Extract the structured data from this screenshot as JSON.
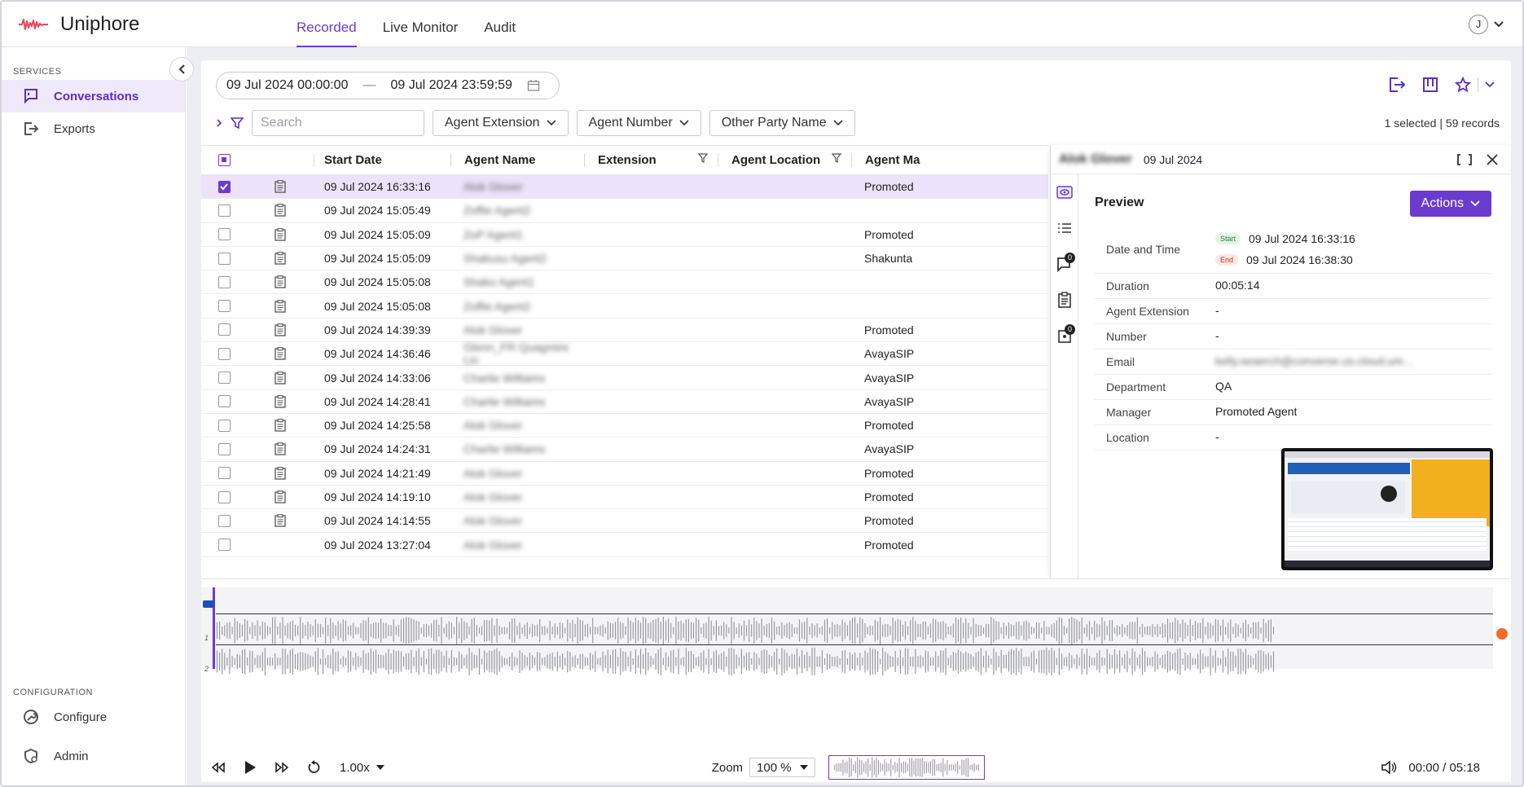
{
  "app": {
    "name": "Uniphore"
  },
  "nav": {
    "tabs": [
      {
        "label": "Recorded",
        "active": true
      },
      {
        "label": "Live Monitor",
        "active": false
      },
      {
        "label": "Audit",
        "active": false
      }
    ]
  },
  "user": {
    "initial": "J"
  },
  "sidebar": {
    "services_label": "SERVICES",
    "items": [
      {
        "label": "Conversations",
        "icon": "chat-icon",
        "active": true
      },
      {
        "label": "Exports",
        "icon": "export-icon",
        "active": false
      }
    ],
    "config_label": "CONFIGURATION",
    "config_items": [
      {
        "label": "Configure",
        "icon": "wrench-icon"
      },
      {
        "label": "Admin",
        "icon": "admin-shield-icon"
      }
    ]
  },
  "date_range": {
    "from": "09 Jul 2024 00:00:00",
    "separator": "—",
    "to": "09 Jul 2024 23:59:59"
  },
  "filters": {
    "search_placeholder": "Search",
    "dropdowns": [
      "Agent Extension",
      "Agent Number",
      "Other Party Name"
    ],
    "records_text": "1 selected | 59 records"
  },
  "table": {
    "headers": {
      "start": "Start Date",
      "agent": "Agent Name",
      "extension": "Extension",
      "location": "Agent Location",
      "manager": "Agent Ma"
    },
    "rows": [
      {
        "start": "09 Jul 2024 16:33:16",
        "agent": "Alok Glover",
        "manager": "Promoted",
        "selected": true,
        "has_icon": true
      },
      {
        "start": "09 Jul 2024 15:05:49",
        "agent": "Zoffie Agent2",
        "manager": "",
        "selected": false,
        "has_icon": true
      },
      {
        "start": "09 Jul 2024 15:05:09",
        "agent": "ZoP Agent1",
        "manager": "Promoted",
        "selected": false,
        "has_icon": true
      },
      {
        "start": "09 Jul 2024 15:05:09",
        "agent": "Shakusu Agent2",
        "manager": "Shakunta",
        "selected": false,
        "has_icon": true
      },
      {
        "start": "09 Jul 2024 15:05:08",
        "agent": "Shako Agent1",
        "manager": "",
        "selected": false,
        "has_icon": true
      },
      {
        "start": "09 Jul 2024 15:05:08",
        "agent": "Zoffie Agent2",
        "manager": "",
        "selected": false,
        "has_icon": true
      },
      {
        "start": "09 Jul 2024 14:39:39",
        "agent": "Alok Glover",
        "manager": "Promoted",
        "selected": false,
        "has_icon": true
      },
      {
        "start": "09 Jul 2024 14:36:46",
        "agent": "Glenn_FR Quagmire Lin",
        "manager": "AvayaSIP",
        "selected": false,
        "has_icon": true
      },
      {
        "start": "09 Jul 2024 14:33:06",
        "agent": "Charlie Williams",
        "manager": "AvayaSIP",
        "selected": false,
        "has_icon": true
      },
      {
        "start": "09 Jul 2024 14:28:41",
        "agent": "Charlie Williams",
        "manager": "AvayaSIP",
        "selected": false,
        "has_icon": true
      },
      {
        "start": "09 Jul 2024 14:25:58",
        "agent": "Alok Glover",
        "manager": "Promoted",
        "selected": false,
        "has_icon": true
      },
      {
        "start": "09 Jul 2024 14:24:31",
        "agent": "Charlie Williams",
        "manager": "AvayaSIP",
        "selected": false,
        "has_icon": true
      },
      {
        "start": "09 Jul 2024 14:21:49",
        "agent": "Alok Glover",
        "manager": "Promoted",
        "selected": false,
        "has_icon": true
      },
      {
        "start": "09 Jul 2024 14:19:10",
        "agent": "Alok Glover",
        "manager": "Promoted",
        "selected": false,
        "has_icon": true
      },
      {
        "start": "09 Jul 2024 14:14:55",
        "agent": "Alok Glover",
        "manager": "Promoted",
        "selected": false,
        "has_icon": true
      },
      {
        "start": "09 Jul 2024 13:27:04",
        "agent": "Alok Glover",
        "manager": "Promoted",
        "selected": false,
        "has_icon": false
      }
    ]
  },
  "panel": {
    "agent_name": "Alok Glover",
    "date": "09 Jul 2024",
    "preview_title": "Preview",
    "actions_label": "Actions",
    "rail_badges": {
      "comments": "0",
      "tags": "0"
    },
    "details": {
      "date_time_label": "Date and Time",
      "start_pill": "Start",
      "start_value": "09 Jul 2024 16:33:16",
      "end_pill": "End",
      "end_value": "09 Jul 2024 16:38:30",
      "rows": [
        {
          "label": "Duration",
          "value": "00:05:14",
          "blur": false
        },
        {
          "label": "Agent Extension",
          "value": "-",
          "blur": false
        },
        {
          "label": "Number",
          "value": "-",
          "blur": false
        },
        {
          "label": "Email",
          "value": "kelly.seaerch@converse.us.cloud.uniphore...",
          "blur": true
        },
        {
          "label": "Department",
          "value": "QA",
          "blur": false
        },
        {
          "label": "Manager",
          "value": "Promoted Agent",
          "blur": false
        },
        {
          "label": "Location",
          "value": "-",
          "blur": false
        }
      ]
    }
  },
  "player": {
    "speed": "1.00x",
    "zoom_label": "Zoom",
    "zoom_value": "100 %",
    "time": "00:00 / 05:18",
    "channels": [
      "1",
      "2"
    ]
  },
  "colors": {
    "accent": "#6b3bd0",
    "selected_row": "#ece2fa",
    "logo": "#e8465a"
  }
}
